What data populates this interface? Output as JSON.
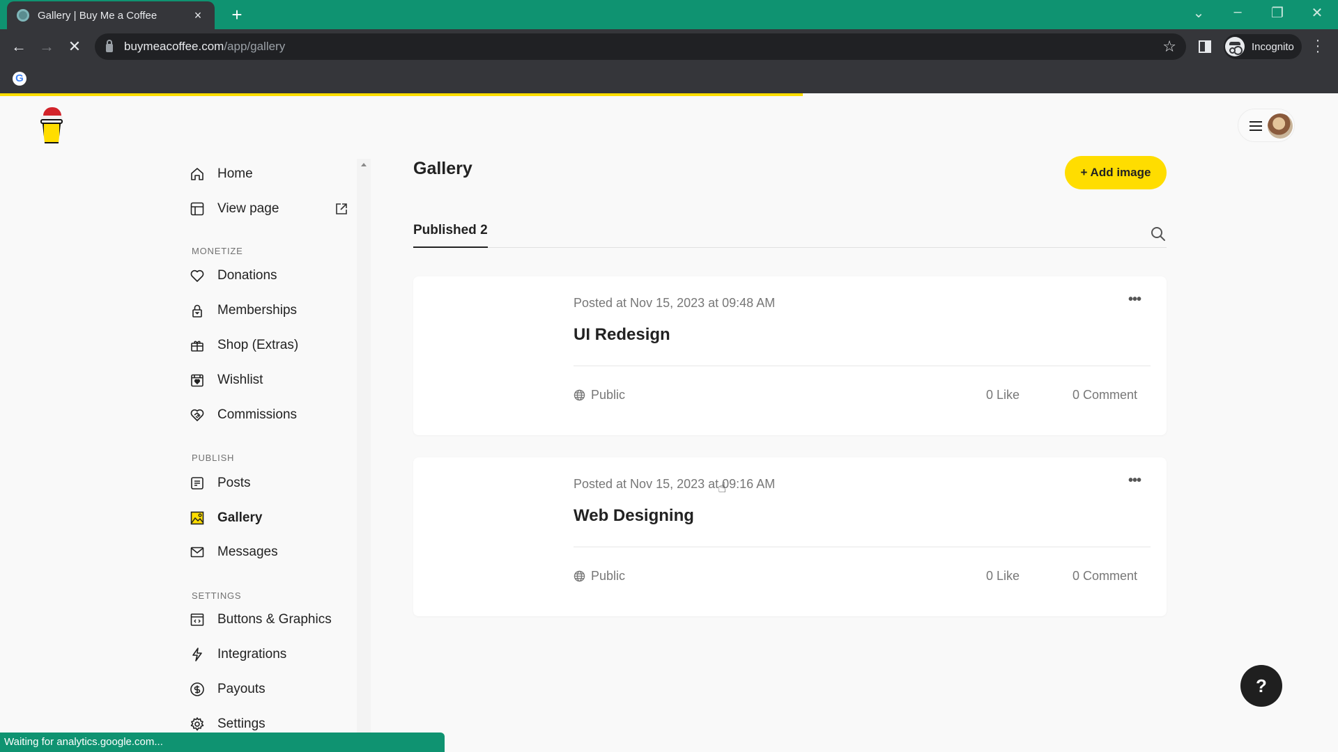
{
  "browser": {
    "tab_title": "Gallery | Buy Me a Coffee",
    "tab_close": "×",
    "new_tab": "+",
    "window_controls": {
      "dropdown": "⌄",
      "minimize": "–",
      "restore": "❐",
      "close": "✕"
    },
    "url_host": "buymeacoffee.com",
    "url_path": "/app/gallery",
    "back": "←",
    "forward": "→",
    "stop": "✕",
    "star": "☆",
    "incognito_label": "Incognito",
    "menu": "⋮",
    "bookmark_google": "G",
    "load_progress": 0.6,
    "status_text": "Waiting for analytics.google.com..."
  },
  "sidebar": {
    "top_items": [
      {
        "label": "Home",
        "icon": "home-icon"
      },
      {
        "label": "View page",
        "icon": "layout-icon",
        "external": true
      }
    ],
    "sections": [
      {
        "title": "MONETIZE",
        "items": [
          {
            "label": "Donations",
            "icon": "heart-icon"
          },
          {
            "label": "Memberships",
            "icon": "lock-icon"
          },
          {
            "label": "Shop (Extras)",
            "icon": "gift-icon"
          },
          {
            "label": "Wishlist",
            "icon": "calendar-heart-icon"
          },
          {
            "label": "Commissions",
            "icon": "handshake-icon"
          }
        ]
      },
      {
        "title": "PUBLISH",
        "items": [
          {
            "label": "Posts",
            "icon": "document-icon"
          },
          {
            "label": "Gallery",
            "icon": "image-icon",
            "active": true
          },
          {
            "label": "Messages",
            "icon": "mail-icon"
          }
        ]
      },
      {
        "title": "SETTINGS",
        "items": [
          {
            "label": "Buttons & Graphics",
            "icon": "code-window-icon"
          },
          {
            "label": "Integrations",
            "icon": "bolt-icon"
          },
          {
            "label": "Payouts",
            "icon": "dollar-icon"
          },
          {
            "label": "Settings",
            "icon": "gear-icon"
          }
        ]
      }
    ]
  },
  "main": {
    "title": "Gallery",
    "add_button": "+ Add image",
    "tabs": [
      {
        "label": "Published 2",
        "active": true
      }
    ],
    "posts": [
      {
        "date": "Posted at Nov 15, 2023 at 09:48 AM",
        "title": "UI Redesign",
        "visibility": "Public",
        "likes": "0 Like",
        "comments": "0 Comment",
        "more": "•••"
      },
      {
        "date": "Posted at Nov 15, 2023 at 09:16 AM",
        "title": "Web Designing",
        "visibility": "Public",
        "likes": "0 Like",
        "comments": "0 Comment",
        "more": "•••"
      }
    ]
  },
  "help_button": "?",
  "colors": {
    "brand_yellow": "#ffdd00",
    "chrome_green": "#0f9371",
    "chrome_dark": "#35363a",
    "text_primary": "#222222",
    "text_muted": "#777777"
  }
}
